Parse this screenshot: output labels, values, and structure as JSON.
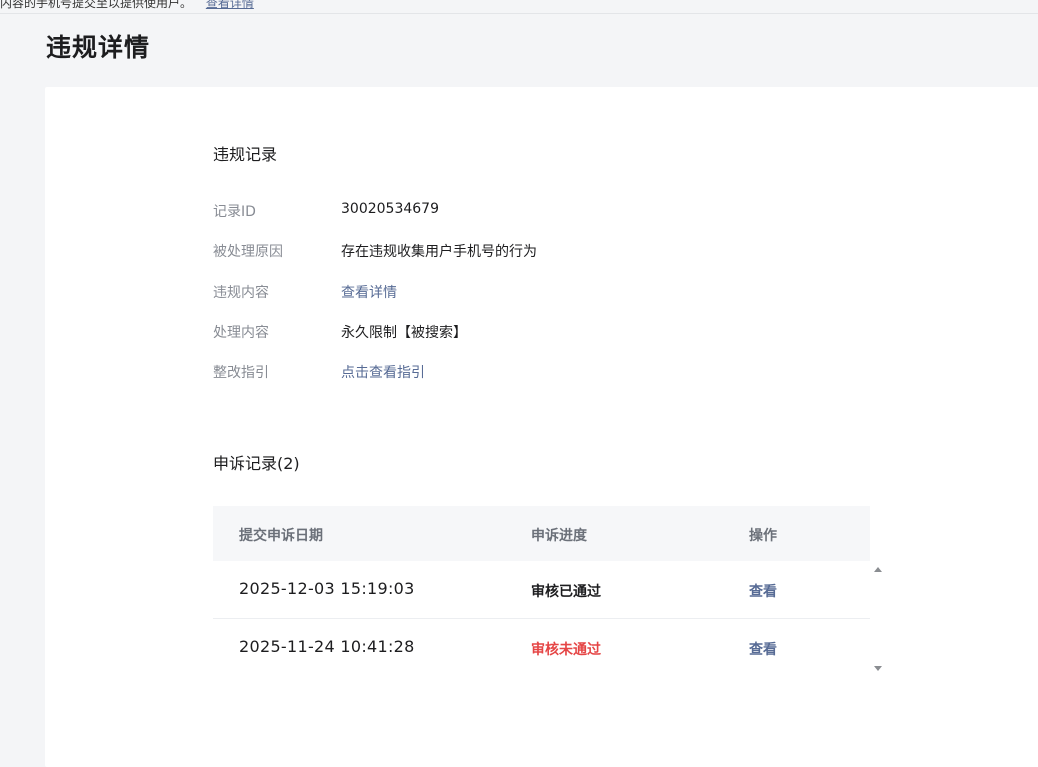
{
  "notice": {
    "text": "内容的手机号提交至以提供使用户。",
    "link": "查看详情"
  },
  "page": {
    "title": "违规详情"
  },
  "violation": {
    "section_title": "违规记录",
    "rows": [
      {
        "label": "记录ID",
        "value": "30020534679",
        "is_link": false
      },
      {
        "label": "被处理原因",
        "value": "存在违规收集用户手机号的行为",
        "is_link": false
      },
      {
        "label": "违规内容",
        "value": "查看详情",
        "is_link": true
      },
      {
        "label": "处理内容",
        "value": "永久限制【被搜索】",
        "is_link": false
      },
      {
        "label": "整改指引",
        "value": "点击查看指引",
        "is_link": true
      }
    ]
  },
  "appeals": {
    "section_title": "申诉记录(2)",
    "columns": [
      "提交申诉日期",
      "申诉进度",
      "操作"
    ],
    "rows": [
      {
        "date": "2025-12-03 15:19:03",
        "status": "审核已通过",
        "status_color": "#1d1d1f",
        "action": "查看"
      },
      {
        "date": "2025-11-24 10:41:28",
        "status": "审核未通过",
        "status_color": "#e54545",
        "action": "查看"
      }
    ]
  },
  "icons": {
    "scroll_up": "arrow-up-icon",
    "scroll_down": "arrow-down-icon"
  }
}
